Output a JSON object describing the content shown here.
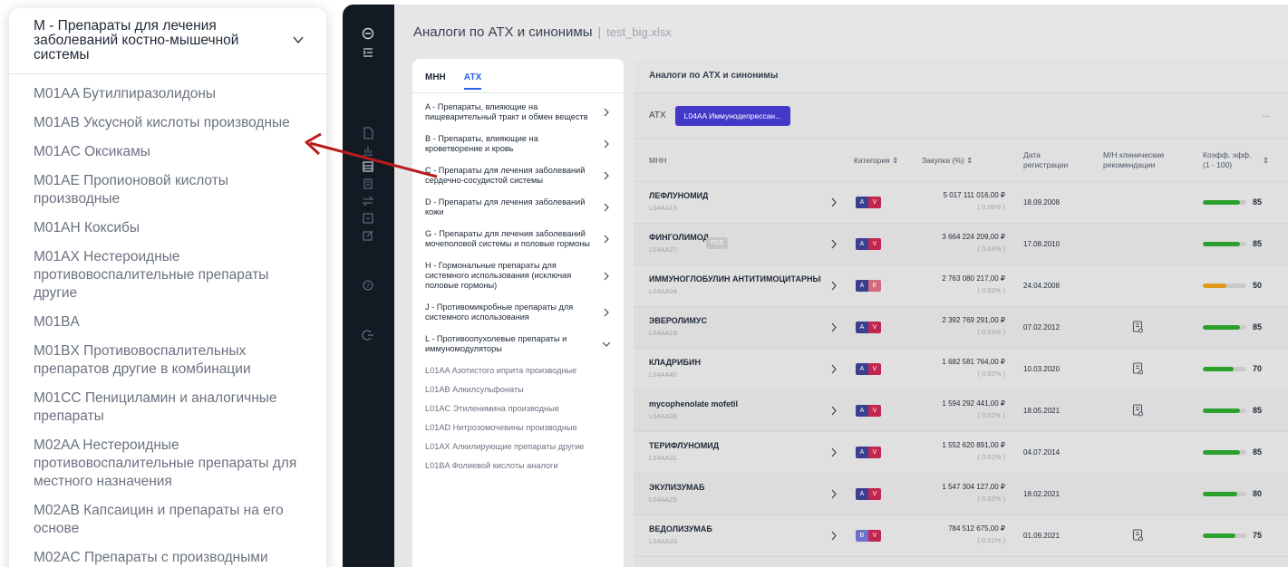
{
  "zoom": {
    "header": "M - Препараты для лечения заболеваний костно-мышечной системы",
    "items": [
      "M01AA Бутилпиразолидоны",
      "M01AB Уксусной кислоты производные",
      "M01AC Оксикамы",
      "M01AE Пропионовой кислоты производные",
      "M01AH Коксибы",
      "M01AX Нестероидные противовоспалительные препараты другие",
      "M01BA",
      "M01BX Противовоспалительных препаратов другие в комбинации",
      "M01CC Пенициламин и аналогичные препараты",
      "M02AA Нестероидные противовоспалительные препараты для местного назначения",
      "M02AB Капсаицин и препараты на его основе",
      "M02AC Препараты с производными"
    ]
  },
  "app": {
    "title": "Аналоги по АТХ и синонимы",
    "separator": "|",
    "filename": "test_big.xlsx"
  },
  "tree": {
    "tabs": [
      "МНН",
      "АТХ"
    ],
    "active_tab": "АТХ",
    "groups": [
      "A - Препараты, влияющие на пищеварительный тракт и обмен веществ",
      "B - Препараты, влияющие на кроветворение и кровь",
      "C - Препараты для лечения заболеваний сердечно-сосудистой системы",
      "D - Препараты для лечения заболеваний кожи",
      "G - Препараты для лечения заболеваний мочеполовой системы и половые гормоны",
      "H - Гормональные препараты для системного использования (исключая половые гормоны)",
      "J - Противомикробные препараты для системного использования",
      "L - Противоопухолевые препараты и иммуномодуляторы"
    ],
    "expanded_group": "L - Противоопухолевые препараты и иммуномодуляторы",
    "subitems": [
      "L01AA Азотистого иприта производные",
      "L01AB Алкилсульфонаты",
      "L01AC Этиленимина производные",
      "L01AD Нитрозомочевины производные",
      "L01AX Алкилирующие препараты другие",
      "L01BA Фолиевой кислоты аналоги"
    ]
  },
  "results": {
    "title": "Аналоги по АТХ и синонимы",
    "filter_label": "АТХ",
    "filter_chip": "L04AA Иммунодепрессан...",
    "more": "...",
    "columns": {
      "mnn": "МНН",
      "category": "Категория ⇕",
      "purchase": "Закупка (%) ⇕",
      "regdate": "Дата регистрации",
      "recommend": "М/Н клинические рекомендации",
      "coef": "Коэфф. эфф. (1 - 100)",
      "coef_sort": "⇕"
    },
    "rows": [
      {
        "name": "ЛЕФЛУНОМИД",
        "code": "L04AA13",
        "fds": "",
        "badge": [
          "A",
          "V"
        ],
        "purchase": "5 017 111 016,00 ₽",
        "pct": "( 0.06% )",
        "date": "18.09.2008",
        "doc": false,
        "score": "85",
        "fill": 0.85,
        "color": "#2ca02c"
      },
      {
        "name": "ФИНГОЛИМОД",
        "code": "L04AA27",
        "fds": "FDS",
        "badge": [
          "A",
          "V"
        ],
        "purchase": "3 664 224 209,00 ₽",
        "pct": "( 0.04% )",
        "date": "17.08.2010",
        "doc": false,
        "score": "85",
        "fill": 0.85,
        "color": "#2ca02c"
      },
      {
        "name": "ИММУНОГЛОБУЛИН АНТИТИМОЦИТАРНЫЙ",
        "code": "L04AA04",
        "fds": "",
        "badge": [
          "A",
          "E"
        ],
        "purchase": "2 763 080 217,00 ₽",
        "pct": "( 0.03% )",
        "date": "24.04.2008",
        "doc": false,
        "score": "50",
        "fill": 0.55,
        "color": "#e09a1a"
      },
      {
        "name": "ЭВЕРОЛИМУС",
        "code": "L04AA18",
        "fds": "",
        "badge": [
          "A",
          "V"
        ],
        "purchase": "2 392 769 291,00 ₽",
        "pct": "( 0.03% )",
        "date": "07.02.2012",
        "doc": true,
        "score": "85",
        "fill": 0.85,
        "color": "#2ca02c"
      },
      {
        "name": "КЛАДРИБИН",
        "code": "L04AA40",
        "fds": "",
        "badge": [
          "A",
          "V"
        ],
        "purchase": "1 682 581 764,00 ₽",
        "pct": "( 0.02% )",
        "date": "10.03.2020",
        "doc": true,
        "score": "70",
        "fill": 0.7,
        "color": "#2ca02c"
      },
      {
        "name": "mycophenolate mofetil",
        "code": "L04AA06",
        "fds": "",
        "badge": [
          "A",
          "V"
        ],
        "purchase": "1 594 292 441,00 ₽",
        "pct": "( 0.02% )",
        "date": "18.05.2021",
        "doc": true,
        "score": "85",
        "fill": 0.85,
        "color": "#2ca02c"
      },
      {
        "name": "ТЕРИФЛУНОМИД",
        "code": "L04AA31",
        "fds": "",
        "badge": [
          "A",
          "V"
        ],
        "purchase": "1 552 620 891,00 ₽",
        "pct": "( 0.02% )",
        "date": "04.07.2014",
        "doc": false,
        "score": "85",
        "fill": 0.85,
        "color": "#2ca02c"
      },
      {
        "name": "ЭКУЛИЗУМАБ",
        "code": "L04AA25",
        "fds": "",
        "badge": [
          "A",
          "V"
        ],
        "purchase": "1 547 304 127,00 ₽",
        "pct": "( 0.02% )",
        "date": "18.02.2021",
        "doc": false,
        "score": "80",
        "fill": 0.8,
        "color": "#2ca02c"
      },
      {
        "name": "ВЕДОЛИЗУМАБ",
        "code": "L04AA33",
        "fds": "",
        "badge": [
          "B",
          "V"
        ],
        "purchase": "784 512 675,00 ₽",
        "pct": "( 0.01% )",
        "date": "01.09.2021",
        "doc": true,
        "score": "75",
        "fill": 0.75,
        "color": "#2ca02c"
      }
    ]
  },
  "colors": {
    "sidebar": "#131a24",
    "accent": "#2563eb",
    "chip": "#4338ca",
    "good": "#2ca02c",
    "warn": "#e09a1a",
    "arrow": "#b91c1c"
  },
  "icons": {
    "sidebar": [
      "logo-icon",
      "collapse-menu-icon",
      "document-icon",
      "chart-icon",
      "table-icon",
      "report-icon",
      "swap-icon",
      "calculator-icon",
      "edit-icon",
      "help-icon",
      "logout-icon"
    ]
  }
}
